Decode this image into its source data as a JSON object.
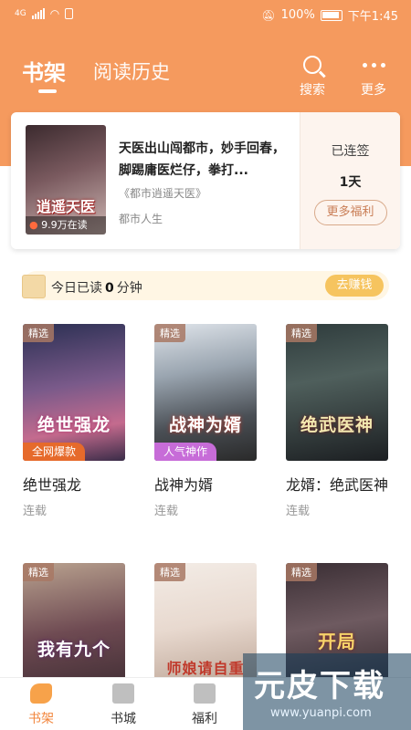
{
  "colors": {
    "header": "#f59a5e",
    "accent": "#f2853c"
  },
  "statusbar": {
    "network": "4G",
    "battery": "100%",
    "time": "下午1:45"
  },
  "header": {
    "tab_active": "书架",
    "tab_history": "阅读历史",
    "search_label": "搜索",
    "more_label": "更多"
  },
  "featured": {
    "cover_title": "逍遥天医",
    "reads": "9.9万在读",
    "title": "天医出山闯都市，妙手回春，脚踢庸医烂仔，拳打...",
    "subtitle": "《都市逍遥天医》",
    "category": "都市人生",
    "signed_label": "已连签",
    "days": "1天",
    "welfare_button": "更多福利"
  },
  "reading": {
    "prefix": "今日已读",
    "minutes": "0",
    "suffix": "分钟",
    "earn_button": "去赚钱"
  },
  "books": [
    {
      "tag": "精选",
      "cover_text": "绝世强龙",
      "band": "全网爆款",
      "name": "绝世强龙",
      "status": "连载"
    },
    {
      "tag": "精选",
      "cover_text": "战神为婿",
      "band": "人气神作",
      "name": "战神为婿",
      "status": "连载"
    },
    {
      "tag": "精选",
      "cover_text": "绝武医神",
      "name": "龙婿：绝武医神",
      "status": "连载"
    },
    {
      "tag": "精选",
      "cover_text": "我有九个"
    },
    {
      "tag": "精选",
      "cover_text": "师娘请自重"
    },
    {
      "tag": "精选",
      "cover_text": "开局"
    }
  ],
  "nav": [
    {
      "label": "书架"
    },
    {
      "label": "书城"
    },
    {
      "label": "福利"
    }
  ],
  "watermark": {
    "main": "元皮下载",
    "url": "www.yuanpi.com"
  }
}
